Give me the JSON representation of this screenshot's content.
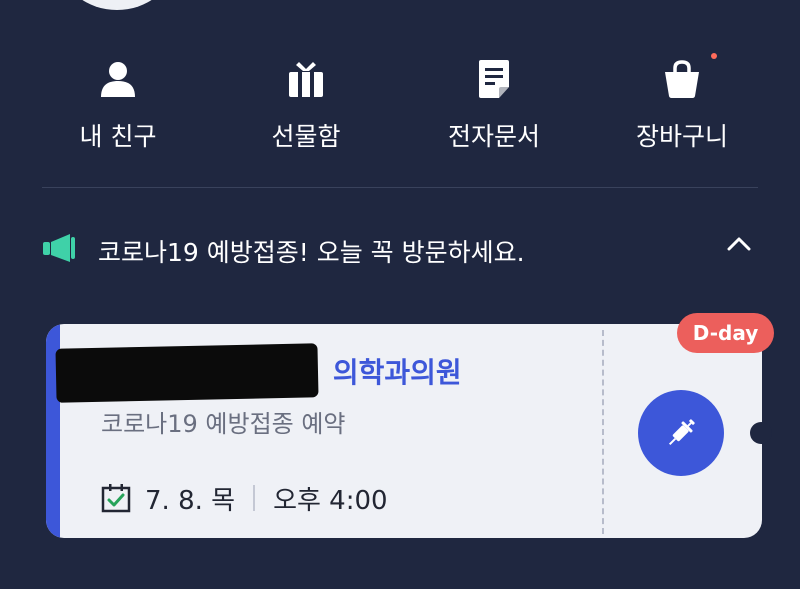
{
  "shortcuts": [
    {
      "label": "내 친구",
      "icon": "person-icon"
    },
    {
      "label": "선물함",
      "icon": "gift-icon"
    },
    {
      "label": "전자문서",
      "icon": "document-icon"
    },
    {
      "label": "장바구니",
      "icon": "shopping-bag-icon",
      "has_badge_dot": true
    }
  ],
  "notice": {
    "icon": "megaphone-icon",
    "text": "코로나19 예방접종! 오늘 꼭 방문하세요.",
    "toggle_icon": "chevron-up-icon"
  },
  "appointment": {
    "clinic_name_visible": "의학과의원",
    "clinic_name_redacted": true,
    "subtitle": "코로나19 예방접종 예약",
    "date": "7. 8. 목",
    "time": "오후 4:00",
    "badge": "D-day",
    "action_icon": "syringe-icon"
  },
  "colors": {
    "background": "#1f2740",
    "accent": "#3d57d9",
    "badge": "#ec5f5c",
    "card": "#eff1f6",
    "calendar_check": "#26a35a"
  }
}
